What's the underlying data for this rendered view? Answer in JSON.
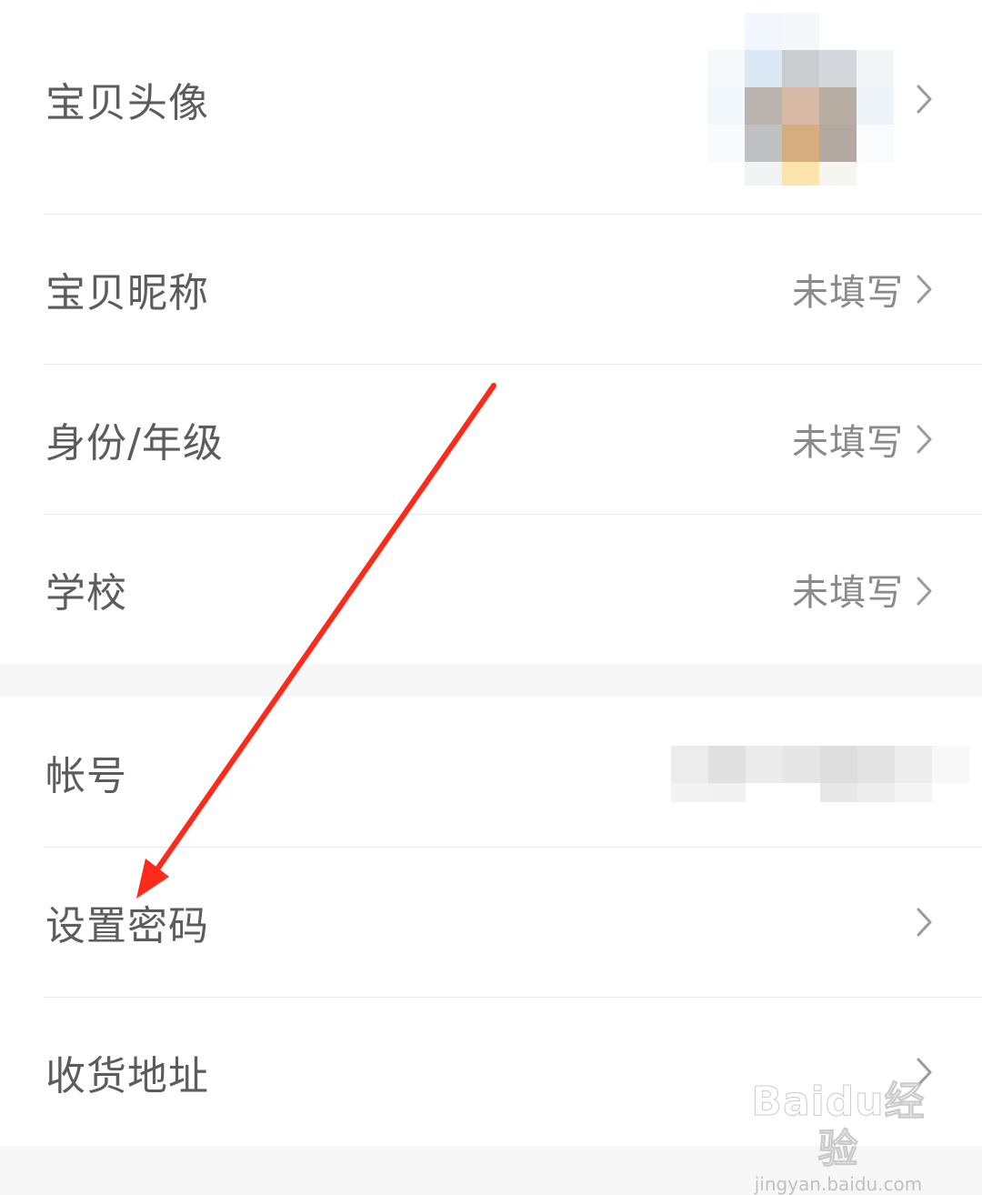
{
  "profile_group": {
    "avatar_row": {
      "label": "宝贝头像"
    },
    "nickname_row": {
      "label": "宝贝昵称",
      "value": "未填写"
    },
    "identity_row": {
      "label": "身份/年级",
      "value": "未填写"
    },
    "school_row": {
      "label": "学校",
      "value": "未填写"
    }
  },
  "account_group": {
    "account_row": {
      "label": "帐号"
    },
    "password_row": {
      "label": "设置密码"
    },
    "address_row": {
      "label": "收货地址"
    }
  },
  "watermark": {
    "logo": "Baidu经验",
    "url": "jingyan.baidu.com"
  },
  "icons": {
    "chevron": "chevron-right-icon",
    "arrow": "red-arrow-annotation"
  },
  "colors": {
    "label_text": "#5c5c5c",
    "value_text": "#8a8a8a",
    "divider": "#e9e9e9",
    "section_gap": "#f7f7f7",
    "annotation_arrow": "#ff2a1a"
  }
}
